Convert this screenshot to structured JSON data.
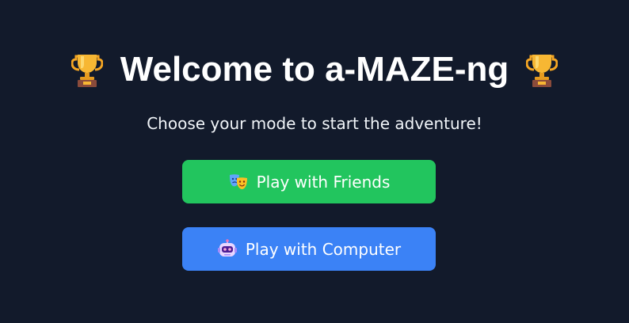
{
  "header": {
    "title": "Welcome to a-MAZE-ng",
    "left_icon": "trophy-icon",
    "right_icon": "trophy-icon"
  },
  "subtitle": "Choose your mode to start the adventure!",
  "modes": {
    "friends": {
      "label": "Play with Friends",
      "icon": "theater-masks-icon",
      "color": "#22c55e"
    },
    "computer": {
      "label": "Play with Computer",
      "icon": "robot-icon",
      "color": "#3b82f6"
    }
  },
  "colors": {
    "background": "#121a2b",
    "text": "#ffffff"
  }
}
